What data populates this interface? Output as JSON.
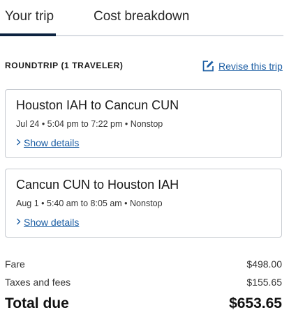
{
  "tabs": [
    {
      "label": "Your trip",
      "active": true
    },
    {
      "label": "Cost breakdown",
      "active": false
    }
  ],
  "trip": {
    "type_label": "ROUNDTRIP (1 TRAVELER)",
    "revise_label": "Revise this trip",
    "revise_icon": "edit-icon"
  },
  "flights": [
    {
      "route": "Houston IAH to Cancun CUN",
      "meta": "Jul 24 • 5:04 pm to 7:22 pm • Nonstop",
      "details_label": "Show details",
      "details_icon": "chevron-right-icon"
    },
    {
      "route": "Cancun CUN to Houston IAH",
      "meta": "Aug 1 • 5:40 am to 8:05 am • Nonstop",
      "details_label": "Show details",
      "details_icon": "chevron-right-icon"
    }
  ],
  "costs": {
    "fare_label": "Fare",
    "fare_value": "$498.00",
    "taxes_label": "Taxes and fees",
    "taxes_value": "$155.65",
    "total_label": "Total due",
    "total_value": "$653.65"
  },
  "colors": {
    "link": "#1c5ea4",
    "tab_underline": "#0c2340",
    "card_border": "#c6cad0"
  }
}
